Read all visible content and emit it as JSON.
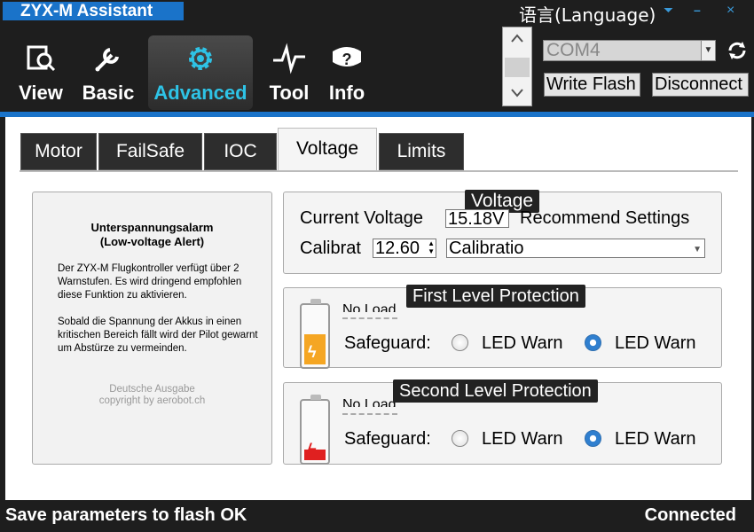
{
  "app": {
    "title": "ZYX-M Assistant",
    "language_label": "语言(Language)",
    "minimize_glyph": "–",
    "close_glyph": "×",
    "dropdown_glyph": "⏷"
  },
  "nav": {
    "items": [
      {
        "label": "View",
        "icon": "view-search-icon"
      },
      {
        "label": "Basic",
        "icon": "wrench-icon"
      },
      {
        "label": "Advanced",
        "icon": "gear-icon",
        "active": true
      },
      {
        "label": "Tool",
        "icon": "pulse-icon"
      },
      {
        "label": "Info",
        "icon": "help-icon"
      }
    ]
  },
  "connection": {
    "port": "COM4",
    "write_flash": "Write Flash",
    "disconnect": "Disconnect"
  },
  "tabs": [
    "Motor",
    "FailSafe",
    "IOC",
    "Voltage",
    "Limits"
  ],
  "active_tab": "Voltage",
  "info_panel": {
    "title_line1": "Unterspannungsalarm",
    "title_line2": "(Low-voltage Alert)",
    "para1": "Der ZYX-M Flugkontroller verfügt über 2 Warnstufen. Es wird dringend empfohlen diese Funktion zu aktivieren.",
    "para2": "Sobald die Spannung der Akkus in einen kritischen Bereich fällt wird der Pilot gewarnt um Abstürze zu vermeinden.",
    "footer_line1": "Deutsche Ausgabe",
    "footer_line2": "copyright by aerobot.ch"
  },
  "voltage": {
    "group_title": "Voltage",
    "current_label": "Current Voltage",
    "current_value": "15.18V",
    "recommend_label": "Recommend Settings",
    "calibrate_label": "Calibrat",
    "calibrate_value": "12.60",
    "calibration_select": "Calibratio"
  },
  "first_level": {
    "title": "First Level Protection",
    "partial_label": "No Load",
    "safeguard_label": "Safeguard:",
    "option1": "LED Warn",
    "option2": "LED Warn",
    "selected": 2,
    "battery_color": "#f5a623"
  },
  "second_level": {
    "title": "Second Level Protection",
    "partial_label": "No Load",
    "safeguard_label": "Safeguard:",
    "option1": "LED Warn",
    "option2": "LED Warn",
    "selected": 2,
    "battery_color": "#e02020"
  },
  "status": {
    "message": "Save parameters to flash OK",
    "connection_state": "Connected"
  },
  "colors": {
    "accent_blue": "#1a73c9",
    "active_nav_text": "#2ec3e6",
    "dark_bg": "#1e1e1e"
  }
}
